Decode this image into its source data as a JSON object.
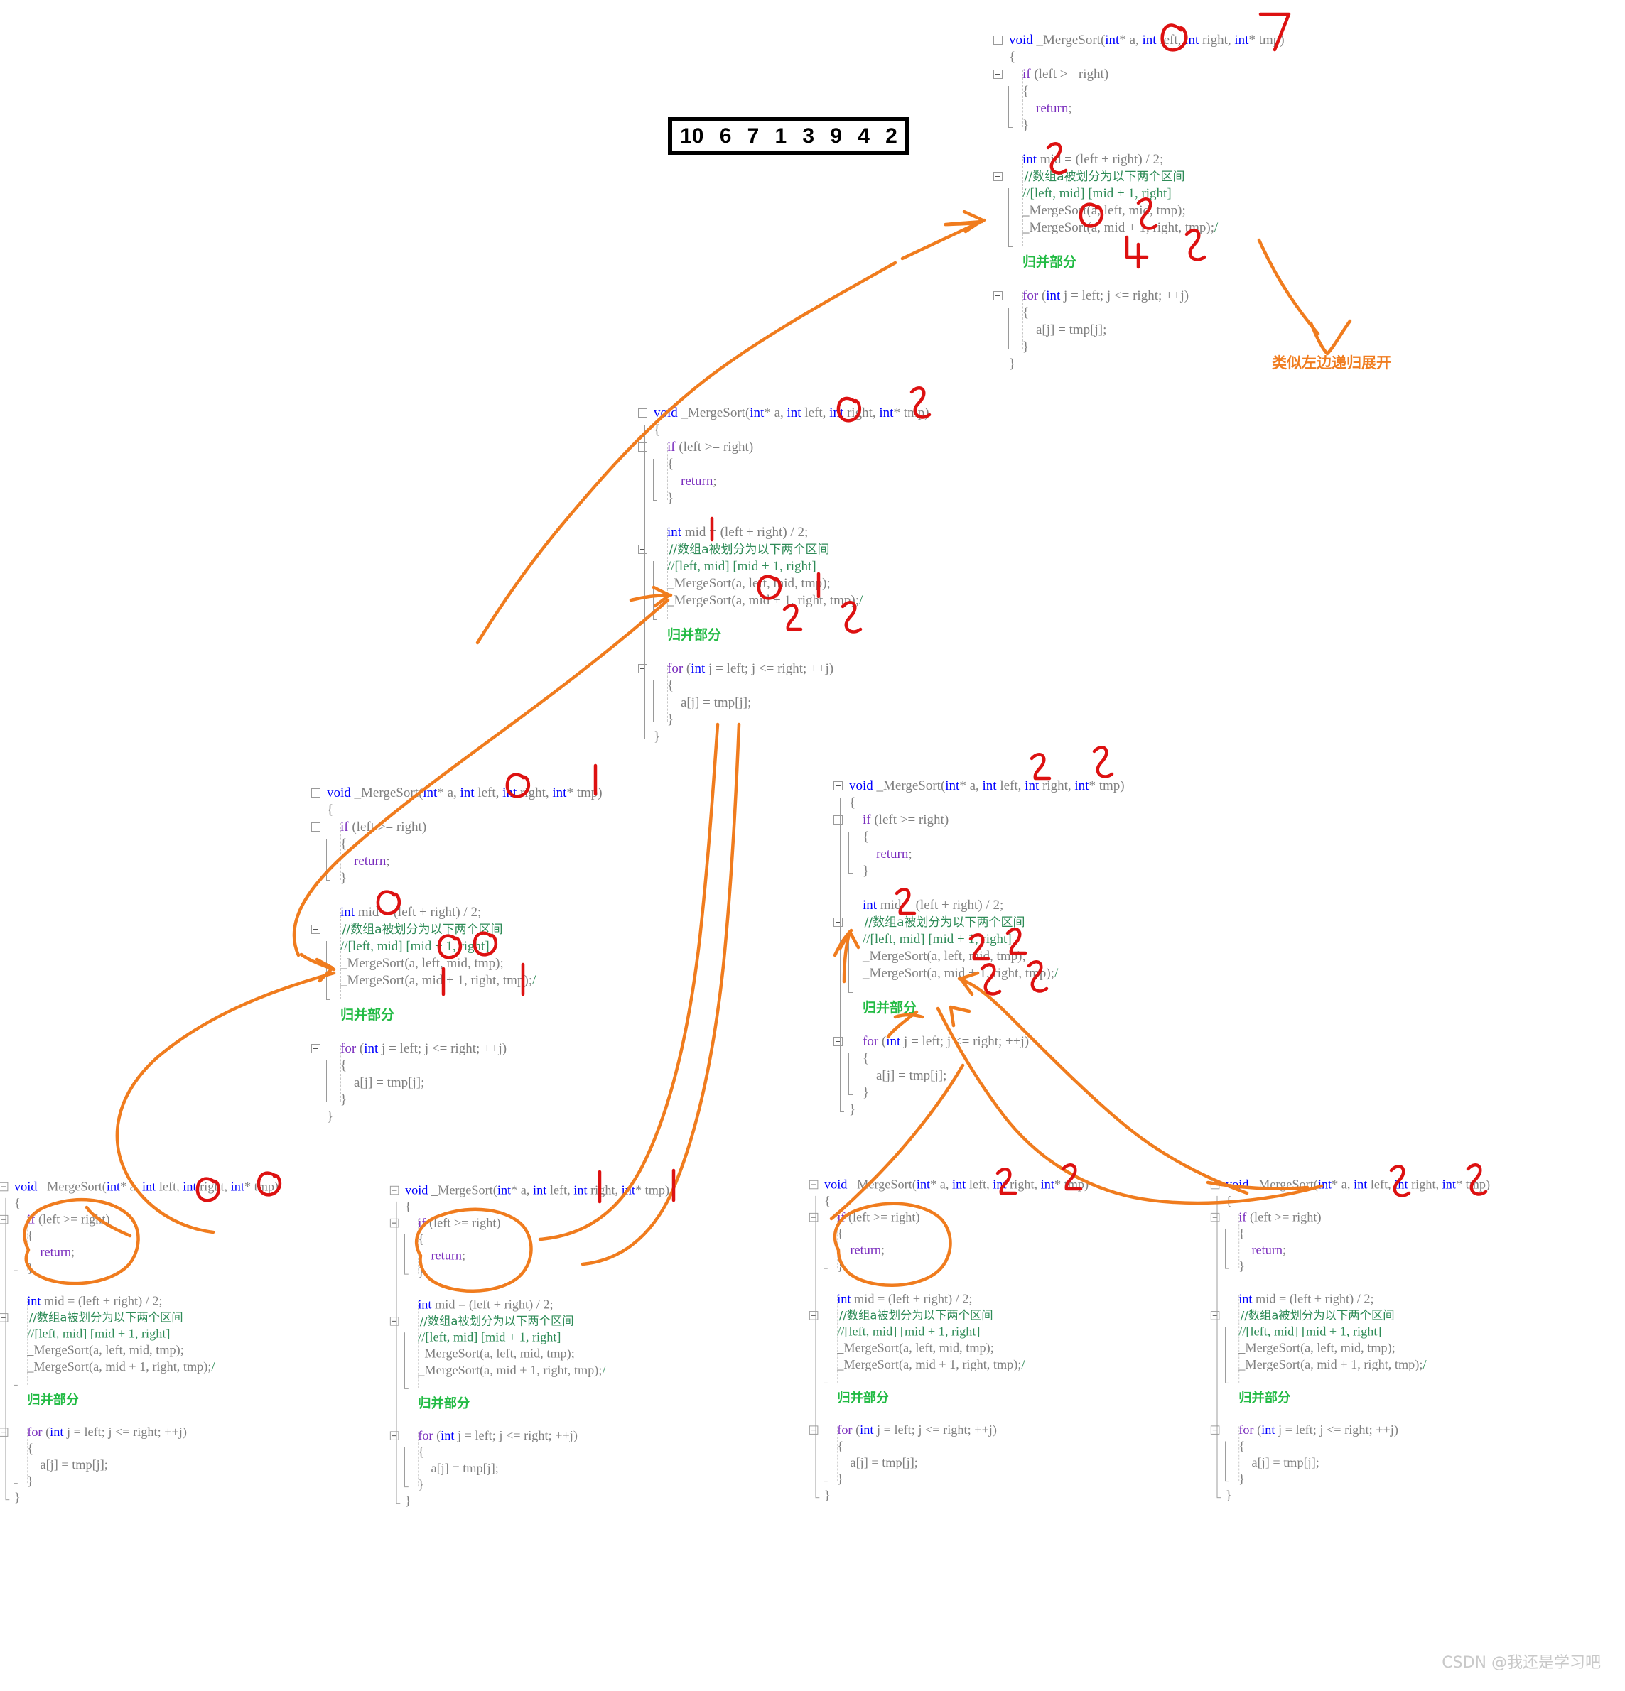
{
  "array": {
    "values": [
      "10",
      "6",
      "7",
      "1",
      "3",
      "9",
      "4",
      "2"
    ]
  },
  "code": {
    "lines": [
      "void _MergeSort(int* a, int left, int right, int* tmp)",
      "{",
      "    if (left >= right)",
      "    {",
      "        return;",
      "    }",
      "",
      "    int mid = (left + right) / 2;",
      "    //数组a被划分为以下两个区间",
      "    //[left, mid] [mid + 1, right]",
      "    _MergeSort(a, left, mid, tmp);",
      "    _MergeSort(a, mid + 1, right, tmp);/",
      "",
      "归并部分",
      "",
      "    for (int j = left; j <= right; ++j)",
      "    {",
      "        a[j] = tmp[j];",
      "    }",
      "}"
    ],
    "merge_label": "归并部分",
    "signature_tokens": {
      "ret": "void",
      "name": "_MergeSort",
      "p1": "int* a",
      "p2": "int left",
      "p3": "int right",
      "p4": "int* tmp"
    }
  },
  "annotations": {
    "recursive_note": "类似左边递归展开",
    "colors": {
      "hand_red": "#dd1111",
      "hand_orange": "#f07c1e",
      "merge_green": "#22bb44",
      "keyword_blue": "#0000ff",
      "keyword_purple": "#7b2fbe",
      "comment_green": "#2e8b57",
      "code_gray": "#808080"
    }
  },
  "blocks": [
    {
      "id": "root",
      "left_mark": "0",
      "right_mark": "7",
      "mid_mark": "3",
      "call1_left": "0",
      "call1_right": "3",
      "call2_left": "4",
      "call2_right": "7"
    },
    {
      "id": "level1-left",
      "left_mark": "0",
      "right_mark": "3",
      "mid_mark": "1",
      "call1_left": "0",
      "call1_right": "1",
      "call2_left": "2",
      "call2_right": "3"
    },
    {
      "id": "level2-left",
      "left_mark": "0",
      "right_mark": "1",
      "mid_mark": "0",
      "call1_left": "0",
      "call1_right": "0",
      "call2_left": "1",
      "call2_right": "1"
    },
    {
      "id": "level2-right",
      "left_mark": "2",
      "right_mark": "3",
      "mid_mark": "2",
      "call1_left": "2",
      "call1_right": "2",
      "call2_left": "3",
      "call2_right": "3"
    },
    {
      "id": "leaf-0",
      "left_mark": "0",
      "right_mark": "0",
      "mid_mark": "",
      "call1_left": "",
      "call1_right": "",
      "call2_left": "",
      "call2_right": ""
    },
    {
      "id": "leaf-1",
      "left_mark": "1",
      "right_mark": "1",
      "mid_mark": "",
      "call1_left": "",
      "call1_right": "",
      "call2_left": "",
      "call2_right": ""
    },
    {
      "id": "leaf-2",
      "left_mark": "2",
      "right_mark": "2",
      "mid_mark": "",
      "call1_left": "",
      "call1_right": "",
      "call2_left": "",
      "call2_right": ""
    },
    {
      "id": "leaf-3",
      "left_mark": "3",
      "right_mark": "3",
      "mid_mark": "",
      "call1_left": "",
      "call1_right": "",
      "call2_left": "",
      "call2_right": ""
    }
  ],
  "watermark": "CSDN @我还是学习吧"
}
